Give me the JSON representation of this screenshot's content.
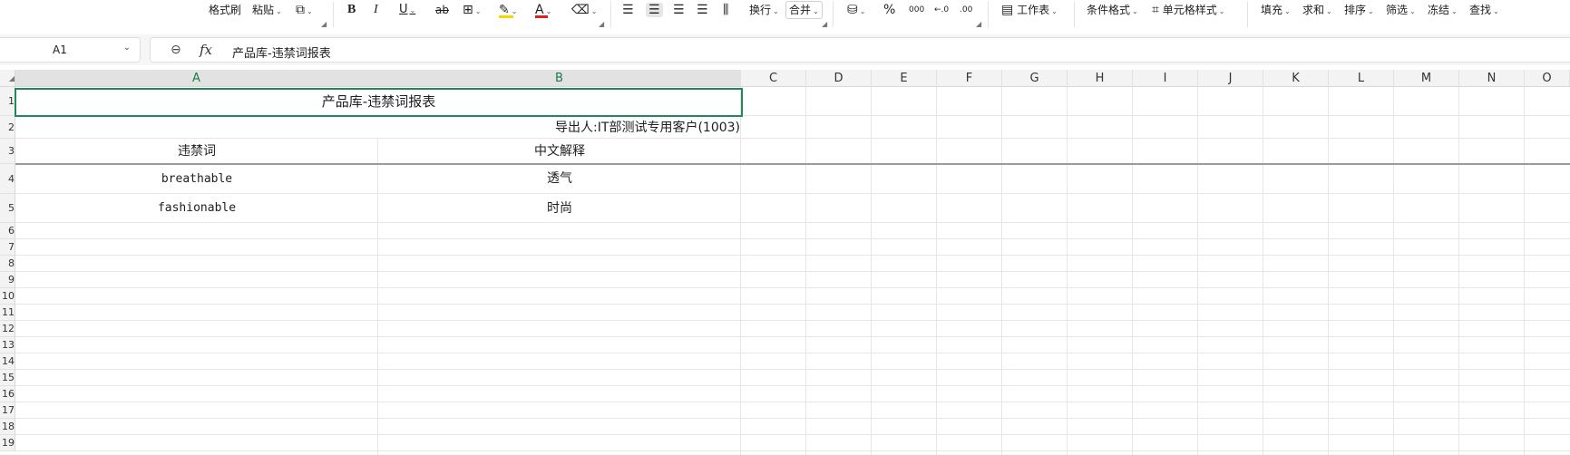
{
  "toolbar": {
    "format_painter": "格式刷",
    "paste": "粘贴",
    "wrap": "换行",
    "merge": "合并",
    "worksheet": "工作表",
    "conditional_format": "条件格式",
    "cell_style": "单元格样式",
    "fill": "填充",
    "sum": "求和",
    "sort": "排序",
    "filter": "筛选",
    "freeze": "冻结",
    "find": "查找",
    "bold": "B",
    "italic": "I",
    "underline": "U",
    "strike": "ab",
    "percent": "%",
    "thousands": "000"
  },
  "formula_bar": {
    "name_box": "A1",
    "formula_value": "产品库-违禁词报表"
  },
  "columns": [
    "A",
    "B",
    "C",
    "D",
    "E",
    "F",
    "G",
    "H",
    "I",
    "J",
    "K",
    "L",
    "M",
    "N",
    "O"
  ],
  "rows": [
    "1",
    "2",
    "3",
    "4",
    "5",
    "6",
    "7",
    "8",
    "9",
    "10",
    "11",
    "12",
    "13",
    "14",
    "15",
    "16",
    "17",
    "18",
    "19"
  ],
  "sheet": {
    "title": "产品库-违禁词报表",
    "exporter": "导出人:IT部测试专用客户(1003)",
    "header_col_a": "违禁词",
    "header_col_b": "中文解释",
    "rows": [
      {
        "word": "breathable",
        "meaning": "透气"
      },
      {
        "word": "fashionable",
        "meaning": "时尚"
      }
    ]
  },
  "colors": {
    "selection": "#1e8a5a",
    "font_color_bar": "#e02020",
    "highlight_bar": "#f5d400"
  }
}
